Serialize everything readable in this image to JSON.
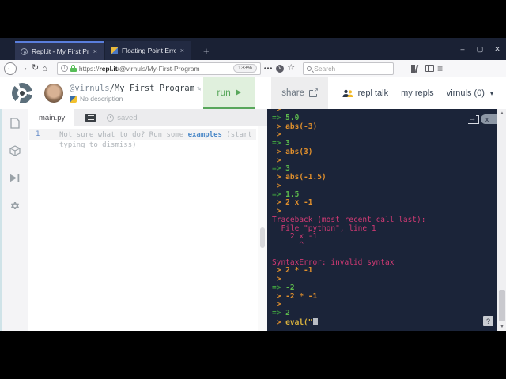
{
  "browser": {
    "tabs": [
      {
        "title": "Repl.it - My First Program",
        "close": "×"
      },
      {
        "title": "Floating Point Error | Mathema",
        "close": "×"
      }
    ],
    "new_tab": "+",
    "window_controls": {
      "minimize": "–",
      "maximize": "▢",
      "close": "✕"
    },
    "nav": {
      "back": "←",
      "forward": "→",
      "reload": "↻",
      "url_scheme": "https://",
      "url_host": "repl.it",
      "url_path": "/@virnuls/My-First-Program",
      "zoom_badge": "133%",
      "menu_dots": "•••",
      "star": "☆",
      "search_placeholder": "Search",
      "hamburger": "≡",
      "info": "i",
      "pocket_check": "v"
    }
  },
  "header": {
    "author": "@virnuls",
    "repl_name": "/My First Program",
    "edit_pencil": "✎",
    "description": "No description",
    "run_label": "run",
    "share_label": "share",
    "repl_talk_label": "repl talk",
    "my_repls_label": "my repls",
    "account_label": "virnuls (0)",
    "caret": "▾"
  },
  "editor": {
    "filename": "main.py",
    "saved_label": "saved",
    "line_number": "1",
    "placeholder_before": "Not sure what to do? Run some ",
    "placeholder_link": "examples",
    "placeholder_after": " (start typing to dismiss)"
  },
  "console": {
    "help_label": "?",
    "close_label": "x",
    "lines": [
      {
        "type": "prompt"
      },
      {
        "type": "out",
        "text": "5.0"
      },
      {
        "type": "cmd",
        "text": "abs(-3)"
      },
      {
        "type": "prompt"
      },
      {
        "type": "out",
        "text": "3"
      },
      {
        "type": "cmd",
        "text": "abs(3)"
      },
      {
        "type": "prompt"
      },
      {
        "type": "out",
        "text": "3"
      },
      {
        "type": "cmd",
        "text": "abs(-1.5)"
      },
      {
        "type": "prompt"
      },
      {
        "type": "out",
        "text": "1.5"
      },
      {
        "type": "cmd",
        "text": "2 x -1"
      },
      {
        "type": "prompt"
      },
      {
        "type": "err",
        "text": "Traceback (most recent call last):"
      },
      {
        "type": "err",
        "text": "  File \"python\", line 1"
      },
      {
        "type": "err",
        "text": "    2 x -1"
      },
      {
        "type": "err",
        "text": "      ^"
      },
      {
        "type": "blank"
      },
      {
        "type": "err",
        "text": "SyntaxError: invalid syntax"
      },
      {
        "type": "cmd",
        "text": "2 * -1"
      },
      {
        "type": "prompt"
      },
      {
        "type": "out",
        "text": "-2"
      },
      {
        "type": "cmd",
        "text": "-2 * -1"
      },
      {
        "type": "prompt"
      },
      {
        "type": "out",
        "text": "2"
      },
      {
        "type": "input",
        "text": "eval(\""
      }
    ]
  },
  "colors": {
    "run_green": "#58a75b",
    "console_bg": "#1b2439",
    "console_prompt": "#e2902c",
    "console_output": "#5dbb4d",
    "console_error": "#d23a74",
    "link_blue": "#4f8bc9",
    "titlebar": "#1a2134"
  }
}
